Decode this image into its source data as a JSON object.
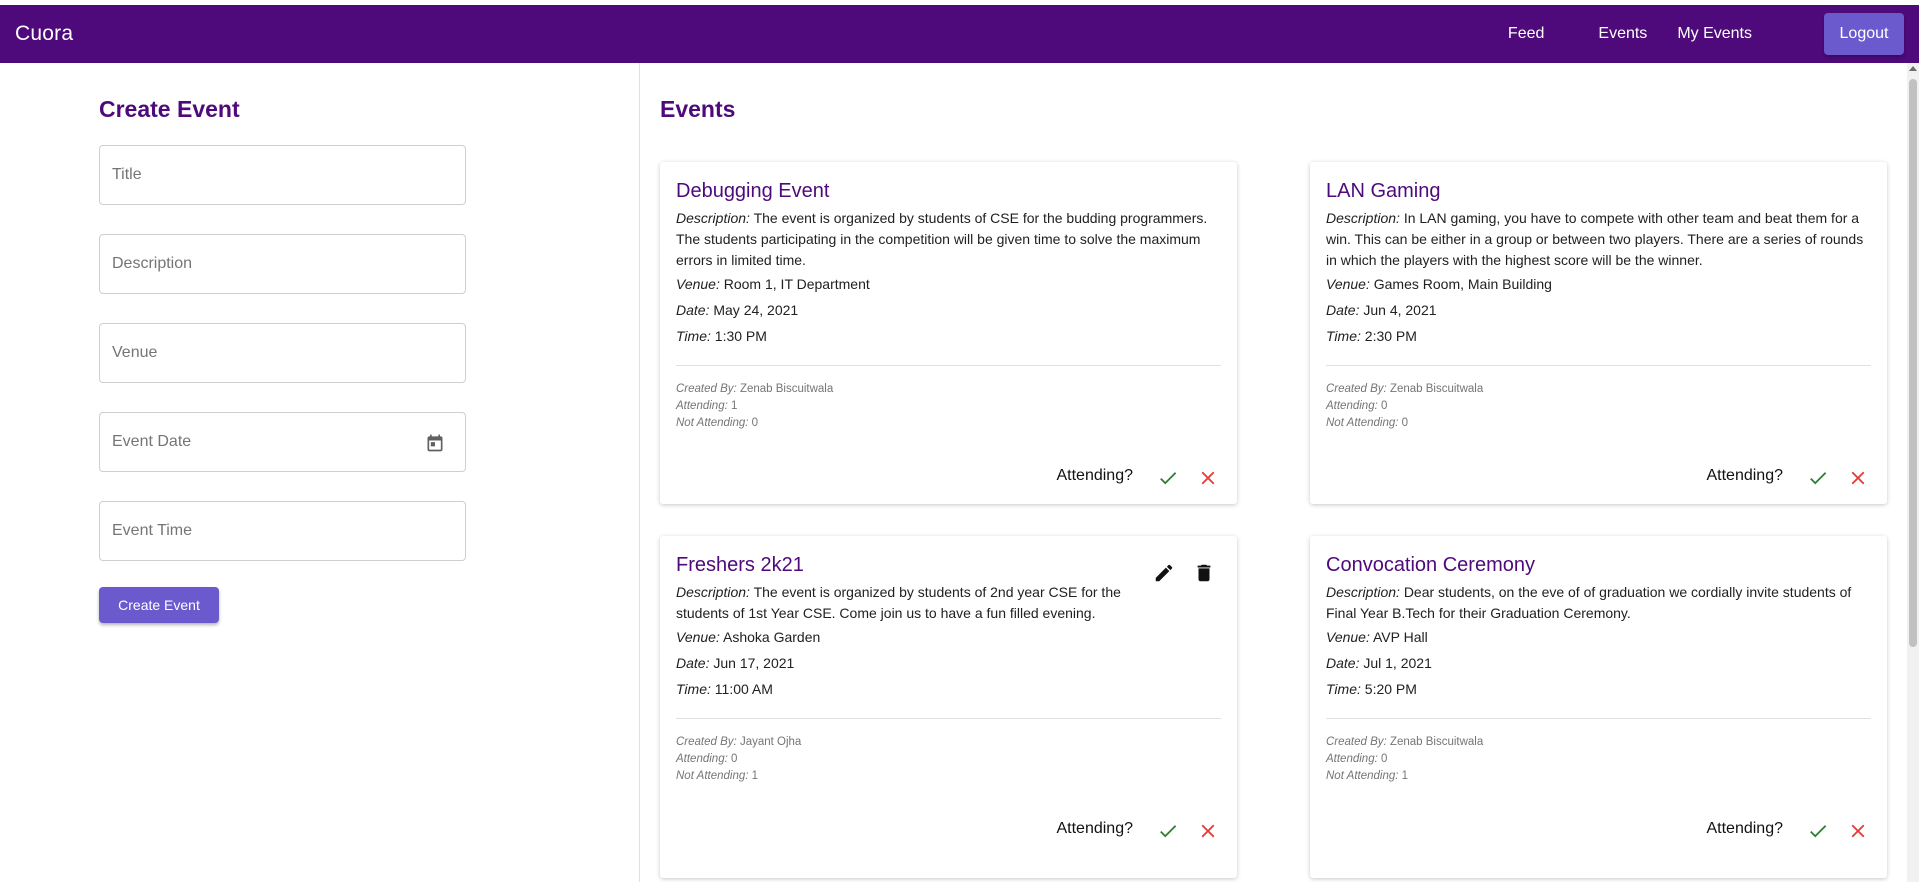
{
  "app": {
    "brand": "Cuora",
    "nav": [
      "Feed",
      "Events",
      "My Events"
    ],
    "logout_label": "Logout"
  },
  "create_form": {
    "title": "Create Event",
    "fields": {
      "title": "Title",
      "description": "Description",
      "venue": "Venue",
      "event_date": "Event Date",
      "event_time": "Event Time"
    },
    "submit_label": "Create Event"
  },
  "events_section": {
    "title": "Events",
    "labels": {
      "description": "Description:",
      "venue": "Venue:",
      "date": "Date:",
      "time": "Time:",
      "created_by": "Created By:",
      "attending": "Attending:",
      "not_attending": "Not Attending:",
      "attending_question": "Attending?"
    },
    "events": [
      {
        "title": "Debugging Event",
        "description": "The event is organized by students of CSE for the budding programmers. The students participating in the competition will be given time to solve the maximum errors in limited time.",
        "venue": "Room 1, IT Department",
        "date": "May 24, 2021",
        "time": "1:30 PM",
        "created_by": "Zenab Biscuitwala",
        "attending": "1",
        "not_attending": "0",
        "editable": false
      },
      {
        "title": "LAN Gaming",
        "description": "In LAN gaming, you have to compete with other team and beat them for a win. This can be either in a group or between two players. There are a series of rounds in which the players with the highest score will be the winner.",
        "venue": "Games Room, Main Building",
        "date": "Jun 4, 2021",
        "time": "2:30 PM",
        "created_by": "Zenab Biscuitwala",
        "attending": "0",
        "not_attending": "0",
        "editable": false
      },
      {
        "title": "Freshers 2k21",
        "description": "The event is organized by students of 2nd year CSE for the students of 1st Year CSE. Come join us to have a fun filled evening.",
        "venue": "Ashoka Garden",
        "date": "Jun 17, 2021",
        "time": "11:00 AM",
        "created_by": "Jayant Ojha",
        "attending": "0",
        "not_attending": "1",
        "editable": true
      },
      {
        "title": "Convocation Ceremony",
        "description": "Dear students, on the eve of of graduation we cordially invite students of Final Year B.Tech for their Graduation Ceremony.",
        "venue": "AVP Hall",
        "date": "Jul 1, 2021",
        "time": "5:20 PM",
        "created_by": "Zenab Biscuitwala",
        "attending": "0",
        "not_attending": "1",
        "editable": false
      }
    ]
  },
  "colors": {
    "appbar": "#4e0a7a",
    "accent_button": "#6a5acd",
    "heading": "#4e0a7a",
    "accept": "#2e7d32",
    "decline": "#e53935"
  },
  "icons": {
    "calendar": "calendar-icon",
    "accept": "check-icon",
    "decline": "close-icon",
    "edit": "pencil-icon",
    "delete": "trash-icon"
  }
}
